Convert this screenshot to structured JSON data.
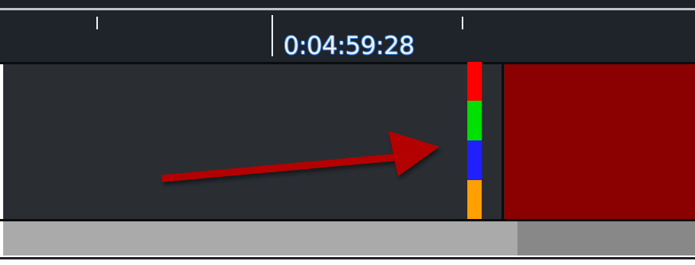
{
  "timeline": {
    "timecode": "0:04:59:28"
  },
  "colors": {
    "track_bg": "#2a2e33",
    "ruler_bg": "#1f242b",
    "clip": "#8b0000",
    "arrow": "#b30000",
    "scroll_thumb": "#aaaaaa",
    "scroll_track": "#888888"
  },
  "marker_colors": [
    "#ff0000",
    "#00e000",
    "#2020ff",
    "#ffa000"
  ],
  "icons": {
    "annotation": "arrow-icon"
  }
}
